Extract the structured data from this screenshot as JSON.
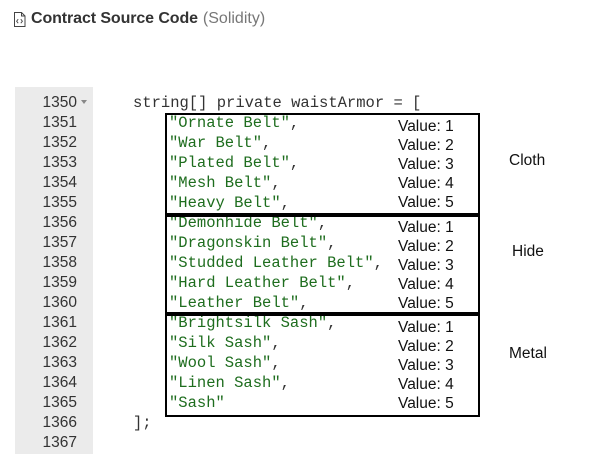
{
  "header": {
    "title": "Contract Source Code",
    "subtitle": "(Solidity)",
    "icon": "file-code-icon"
  },
  "lines": [
    {
      "num": "1350",
      "code": "string[] private waistArmor = [",
      "fold": true
    },
    {
      "num": "1351",
      "code": "\"Ornate Belt\","
    },
    {
      "num": "1352",
      "code": "\"War Belt\","
    },
    {
      "num": "1353",
      "code": "\"Plated Belt\","
    },
    {
      "num": "1354",
      "code": "\"Mesh Belt\","
    },
    {
      "num": "1355",
      "code": "\"Heavy Belt\","
    },
    {
      "num": "1356",
      "code": "\"Demonhide Belt\","
    },
    {
      "num": "1357",
      "code": "\"Dragonskin Belt\","
    },
    {
      "num": "1358",
      "code": "\"Studded Leather Belt\","
    },
    {
      "num": "1359",
      "code": "\"Hard Leather Belt\","
    },
    {
      "num": "1360",
      "code": "\"Leather Belt\","
    },
    {
      "num": "1361",
      "code": "\"Brightsilk Sash\","
    },
    {
      "num": "1362",
      "code": "\"Silk Sash\","
    },
    {
      "num": "1363",
      "code": "\"Wool Sash\","
    },
    {
      "num": "1364",
      "code": "\"Linen Sash\","
    },
    {
      "num": "1365",
      "code": "\"Sash\""
    },
    {
      "num": "1366",
      "code": "];"
    },
    {
      "num": "1367",
      "code": ""
    }
  ],
  "groups": [
    {
      "label": "Cloth",
      "values": [
        "Value: 1",
        "Value: 2",
        "Value: 3",
        "Value: 4",
        "Value: 5"
      ]
    },
    {
      "label": "Hide",
      "values": [
        "Value: 1",
        "Value: 2",
        "Value: 3",
        "Value: 4",
        "Value: 5"
      ]
    },
    {
      "label": "Metal",
      "values": [
        "Value: 1",
        "Value: 2",
        "Value: 3",
        "Value: 4",
        "Value: 5"
      ]
    }
  ],
  "colors": {
    "string": "#1e6d1e",
    "gutter": "#ebebeb",
    "annotation_border": "#000000"
  }
}
